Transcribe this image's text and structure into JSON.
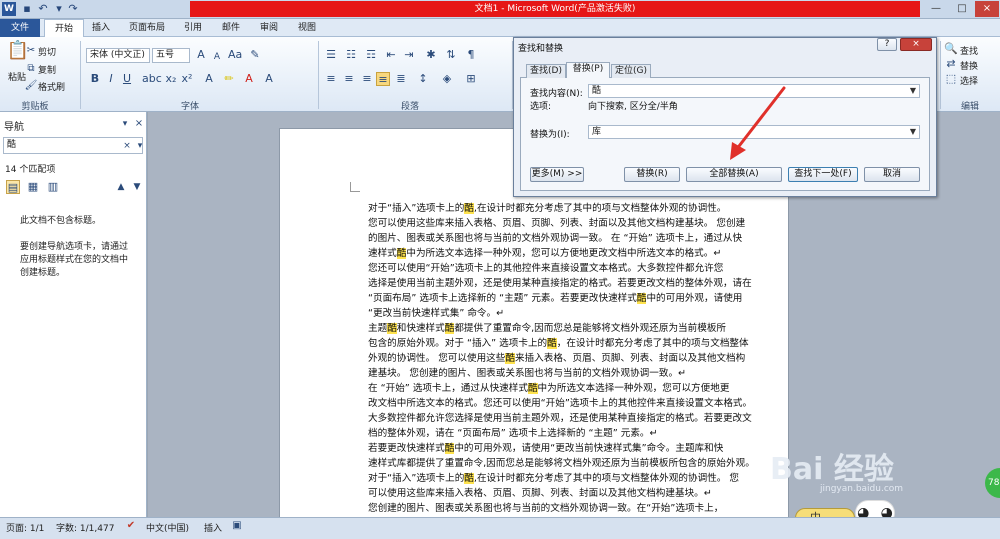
{
  "window": {
    "title": "文档1 - Microsoft Word(产品激活失败)"
  },
  "tabs": [
    "文件",
    "开始",
    "插入",
    "页面布局",
    "引用",
    "邮件",
    "审阅",
    "视图"
  ],
  "ribbon": {
    "clipboard": {
      "paste": "粘贴",
      "cut": "剪切",
      "copy": "复制",
      "format_painter": "格式刷",
      "label": "剪贴板"
    },
    "font": {
      "name": "宋体 (中文正)",
      "size": "五号",
      "label": "字体"
    },
    "paragraph": {
      "label": "段落"
    },
    "editing": {
      "find": "查找",
      "replace": "替换",
      "select": "选择",
      "label": "编辑"
    }
  },
  "nav": {
    "title": "导航",
    "search_value": "酷",
    "match_count": "14 个匹配项",
    "no_headings": "此文档不包含标题。",
    "hint": [
      "要创建导航选项卡，请通过",
      "应用标题样式在您的文档中",
      "创建标题。"
    ]
  },
  "dialog": {
    "title": "查找和替换",
    "tabs": [
      "查找(D)",
      "替换(P)",
      "定位(G)"
    ],
    "find_label": "查找内容(N):",
    "find_value": "酷",
    "options_label": "选项:",
    "options_value": "向下搜索, 区分全/半角",
    "replace_label": "替换为(I):",
    "replace_value": "库",
    "buttons": {
      "more": "更多(M) >>",
      "replace": "替换(R)",
      "replace_all": "全部替换(A)",
      "find_next": "查找下一处(F)",
      "cancel": "取消"
    },
    "help": "?",
    "close": "×"
  },
  "document": {
    "lines": [
      "对于“插入”选项卡上的酷,在设计时都充分考虑了其中的项与文档整体外观的协调性。",
      "您可以使用这些库来插入表格、页眉、页脚、列表、封面以及其他文档构建基块。 您创建",
      "的图片、图表或关系图也将与当前的文档外观协调一致。 在 “开始” 选项卡上，通过从快",
      "速样式酷中为所选文本选择一种外观，您可以方便地更改文档中所选文本的格式。↵",
      "您还可以使用“开始”选项卡上的其他控件来直接设置文本格式。大多数控件都允许您",
      "选择是使用当前主题外观，还是使用某种直接指定的格式。若要更改文档的整体外观，请在",
      "“页面布局” 选项卡上选择新的 “主题” 元素。若要更改快速样式酷中的可用外观，请使用",
      "“更改当前快速样式集” 命令。↵",
      "主题酷和快速样式酷都提供了重置命令,因而您总是能够将文档外观还原为当前模板所",
      "包含的原始外观。对于 “插入” 选项卡上的酷，在设计时都充分考虑了其中的项与文档整体",
      "外观的协调性。 您可以使用这些酷来插入表格、页眉、页脚、列表、封面以及其他文档构",
      "建基块。 您创建的图片、图表或关系图也将与当前的文档外观协调一致。↵",
      "在 “开始” 选项卡上，通过从快速样式酷中为所选文本选择一种外观，您可以方便地更",
      "改文档中所选文本的格式。您还可以使用“开始”选项卡上的其他控件来直接设置文本格式。",
      "大多数控件都允许您选择是使用当前主题外观，还是使用某种直接指定的格式。若要更改文",
      "档的整体外观，请在 “页面布局” 选项卡上选择新的 “主题” 元素。↵",
      "若要更改快速样式酷中的可用外观，请使用“更改当前快速样式集”命令。主题库和快",
      "速样式库都提供了重置命令,因而您总是能够将文档外观还原为当前模板所包含的原始外观。",
      "对于“插入”选项卡上的酷,在设计时都充分考虑了其中的项与文档整体外观的协调性。 您",
      "可以使用这些库来插入表格、页眉、页脚、列表、封面以及其他文档构建基块。↵",
      "您创建的图片、图表或关系图也将与当前的文档外观协调一致。在“开始”选项卡上，"
    ]
  },
  "status": {
    "page": "页面: 1/1",
    "words": "字数: 1/1,477",
    "language": "中文(中国)",
    "insert": "插入"
  },
  "watermark": {
    "text": "Bai 经验",
    "url": "jingyan.baidu.com",
    "ime": "中"
  },
  "colors": {
    "title_red": "#e61616",
    "highlight": "#ffe34d",
    "arrow": "#e0302a",
    "file_tab": "#2b579a"
  }
}
